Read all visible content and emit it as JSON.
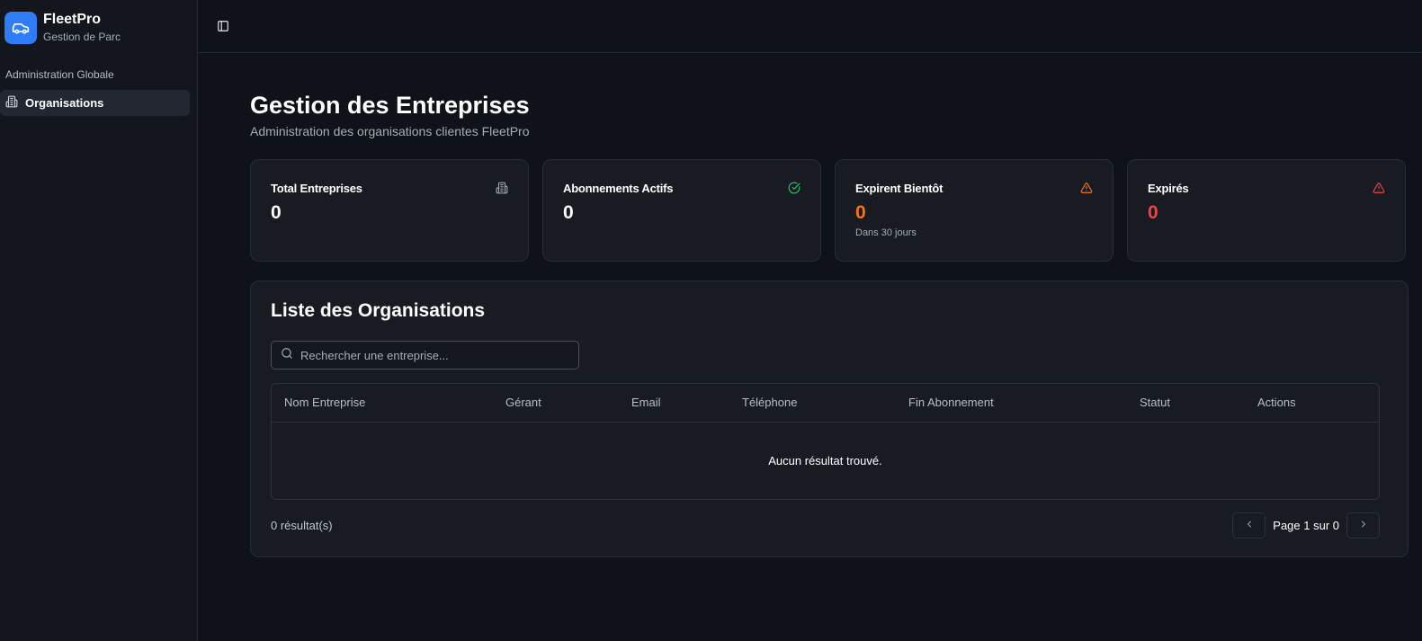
{
  "brand": {
    "name": "FleetPro",
    "subtitle": "Gestion de Parc"
  },
  "sidebar": {
    "section_label": "Administration Globale",
    "items": [
      {
        "label": "Organisations",
        "icon": "building-icon"
      }
    ]
  },
  "page": {
    "title": "Gestion des Entreprises",
    "subtitle": "Administration des organisations clientes FleetPro"
  },
  "stats": [
    {
      "label": "Total Entreprises",
      "value": "0",
      "note": "",
      "icon": "building-icon",
      "color": "#ffffff",
      "icon_color": "#9ca3af"
    },
    {
      "label": "Abonnements Actifs",
      "value": "0",
      "note": "",
      "icon": "check-circle-icon",
      "color": "#ffffff",
      "icon_color": "#22c55e"
    },
    {
      "label": "Expirent Bientôt",
      "value": "0",
      "note": "Dans 30 jours",
      "icon": "warning-icon",
      "color": "#f97316",
      "icon_color": "#f97316"
    },
    {
      "label": "Expirés",
      "value": "0",
      "note": "",
      "icon": "warning-icon",
      "color": "#ef4444",
      "icon_color": "#ef4444"
    }
  ],
  "list": {
    "title": "Liste des Organisations",
    "search_placeholder": "Rechercher une entreprise...",
    "columns": [
      "Nom Entreprise",
      "Gérant",
      "Email",
      "Téléphone",
      "Fin Abonnement",
      "Statut",
      "Actions"
    ],
    "empty_message": "Aucun résultat trouvé.",
    "result_count": "0 résultat(s)",
    "pagination": "Page 1 sur 0"
  }
}
